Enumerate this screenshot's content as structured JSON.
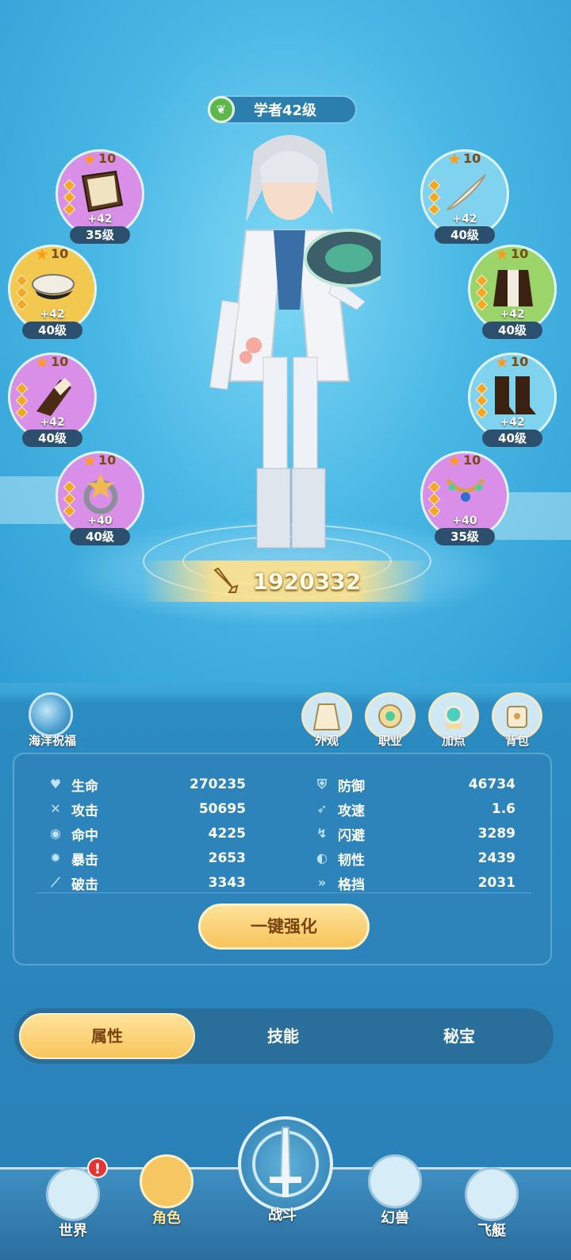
{
  "class_badge": {
    "label": "学者42级"
  },
  "equipment_left": [
    {
      "name": "book",
      "stars": "10",
      "bonus": "+42",
      "level": "35级",
      "color": "#d98ee8"
    },
    {
      "name": "captain-hat",
      "stars": "10",
      "bonus": "+42",
      "level": "40级",
      "color": "#f2c84f"
    },
    {
      "name": "bracer",
      "stars": "10",
      "bonus": "+42",
      "level": "40级",
      "color": "#d98ee8"
    },
    {
      "name": "ring",
      "stars": "10",
      "bonus": "+40",
      "level": "40级",
      "color": "#d98ee8"
    }
  ],
  "equipment_right": [
    {
      "name": "quill",
      "stars": "10",
      "bonus": "+42",
      "level": "40级",
      "color": "#7fd3ef"
    },
    {
      "name": "vest",
      "stars": "10",
      "bonus": "+42",
      "level": "40级",
      "color": "#9bd56a"
    },
    {
      "name": "boots",
      "stars": "10",
      "bonus": "+42",
      "level": "40级",
      "color": "#7fd3ef"
    },
    {
      "name": "necklace",
      "stars": "10",
      "bonus": "+40",
      "level": "35级",
      "color": "#d98ee8"
    }
  ],
  "power": {
    "value": "1920332"
  },
  "blessing": {
    "label": "海洋祝福"
  },
  "functions": [
    {
      "label": "外观",
      "icon": "coat-icon"
    },
    {
      "label": "职业",
      "icon": "class-emblem-icon"
    },
    {
      "label": "加点",
      "icon": "gem-icon"
    },
    {
      "label": "背包",
      "icon": "backpack-icon"
    }
  ],
  "stats_left": [
    {
      "label": "生命",
      "value": "270235",
      "icon": "heart-icon"
    },
    {
      "label": "攻击",
      "value": "50695",
      "icon": "swords-icon"
    },
    {
      "label": "命中",
      "value": "4225",
      "icon": "target-icon"
    },
    {
      "label": "暴击",
      "value": "2653",
      "icon": "burst-icon"
    },
    {
      "label": "破击",
      "value": "3343",
      "icon": "pierce-icon"
    }
  ],
  "stats_right": [
    {
      "label": "防御",
      "value": "46734",
      "icon": "shield-icon"
    },
    {
      "label": "攻速",
      "value": "1.6",
      "icon": "speed-icon"
    },
    {
      "label": "闪避",
      "value": "3289",
      "icon": "dodge-icon"
    },
    {
      "label": "韧性",
      "value": "2439",
      "icon": "toughness-icon"
    },
    {
      "label": "格挡",
      "value": "2031",
      "icon": "block-icon"
    }
  ],
  "enhance_button": {
    "label": "一键强化"
  },
  "tabs": [
    {
      "label": "属性",
      "active": true
    },
    {
      "label": "技能",
      "active": false
    },
    {
      "label": "秘宝",
      "active": false
    }
  ],
  "nav": [
    {
      "label": "世界",
      "icon": "world-icon",
      "badge": "!"
    },
    {
      "label": "角色",
      "icon": "character-icon",
      "active": true
    },
    {
      "label": "战斗",
      "icon": "sword-icon"
    },
    {
      "label": "幻兽",
      "icon": "beast-icon"
    },
    {
      "label": "飞艇",
      "icon": "airship-icon"
    }
  ]
}
